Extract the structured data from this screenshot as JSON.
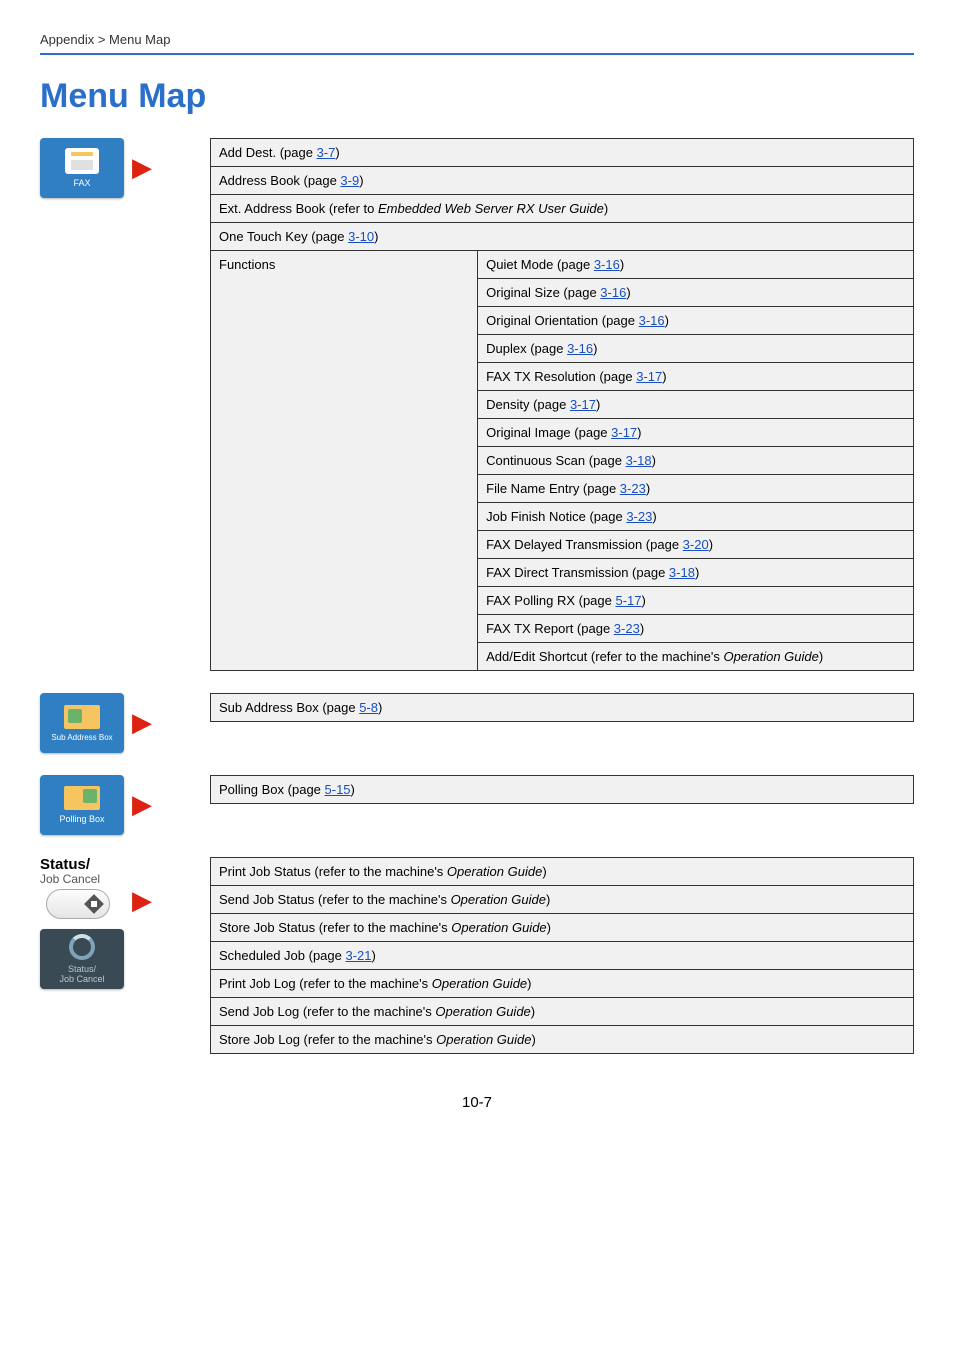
{
  "breadcrumb": "Appendix > Menu Map",
  "title": "Menu Map",
  "page_number": "10-7",
  "fax_tile_label": "FAX",
  "sub_tile_label": "Sub Address Box",
  "poll_tile_label": "Polling Box",
  "status_label_line1": "Status/",
  "status_label_line2": "Job Cancel",
  "status_screen_line1": "Status/",
  "status_screen_line2": "Job Cancel",
  "fax_table": {
    "rows": [
      {
        "full": [
          {
            "t": "Add Dest. (page "
          },
          {
            "link": "3-7"
          },
          {
            "t": ")"
          }
        ]
      },
      {
        "full": [
          {
            "t": "Address Book (page "
          },
          {
            "link": "3-9"
          },
          {
            "t": ")"
          }
        ]
      },
      {
        "full": [
          {
            "t": "Ext. Address Book (refer to "
          },
          {
            "i": "Embedded Web Server RX User Guide"
          },
          {
            "t": ")"
          }
        ]
      },
      {
        "full": [
          {
            "t": "One Touch Key (page "
          },
          {
            "link": "3-10"
          },
          {
            "t": ")"
          }
        ]
      }
    ],
    "functions_label": "Functions",
    "functions": [
      [
        {
          "t": "Quiet Mode (page "
        },
        {
          "link": "3-16"
        },
        {
          "t": ")"
        }
      ],
      [
        {
          "t": "Original Size (page "
        },
        {
          "link": "3-16"
        },
        {
          "t": ")"
        }
      ],
      [
        {
          "t": "Original Orientation (page "
        },
        {
          "link": "3-16"
        },
        {
          "t": ")"
        }
      ],
      [
        {
          "t": "Duplex (page "
        },
        {
          "link": "3-16"
        },
        {
          "t": ")"
        }
      ],
      [
        {
          "t": "FAX TX Resolution (page "
        },
        {
          "link": "3-17"
        },
        {
          "t": ")"
        }
      ],
      [
        {
          "t": "Density (page "
        },
        {
          "link": "3-17"
        },
        {
          "t": ")"
        }
      ],
      [
        {
          "t": "Original Image (page "
        },
        {
          "link": "3-17"
        },
        {
          "t": ")"
        }
      ],
      [
        {
          "t": "Continuous Scan (page "
        },
        {
          "link": "3-18"
        },
        {
          "t": ")"
        }
      ],
      [
        {
          "t": "File Name Entry (page "
        },
        {
          "link": "3-23"
        },
        {
          "t": ")"
        }
      ],
      [
        {
          "t": "Job Finish Notice (page "
        },
        {
          "link": "3-23"
        },
        {
          "t": ")"
        }
      ],
      [
        {
          "t": "FAX Delayed Transmission (page "
        },
        {
          "link": "3-20"
        },
        {
          "t": ")"
        }
      ],
      [
        {
          "t": "FAX Direct Transmission (page "
        },
        {
          "link": "3-18"
        },
        {
          "t": ")"
        }
      ],
      [
        {
          "t": "FAX Polling RX (page "
        },
        {
          "link": "5-17"
        },
        {
          "t": ")"
        }
      ],
      [
        {
          "t": "FAX TX Report (page "
        },
        {
          "link": "3-23"
        },
        {
          "t": ")"
        }
      ],
      [
        {
          "t": "Add/Edit Shortcut (refer to the machine's "
        },
        {
          "i": "Operation Guide"
        },
        {
          "t": ")"
        }
      ]
    ]
  },
  "sub_row": [
    {
      "t": "Sub Address Box (page "
    },
    {
      "link": "5-8"
    },
    {
      "t": ")"
    }
  ],
  "poll_row": [
    {
      "t": "Polling Box (page "
    },
    {
      "link": "5-15"
    },
    {
      "t": ")"
    }
  ],
  "status_rows": [
    [
      {
        "t": "Print Job Status (refer to the machine's "
      },
      {
        "i": "Operation Guide"
      },
      {
        "t": ")"
      }
    ],
    [
      {
        "t": "Send Job Status (refer to the machine's "
      },
      {
        "i": "Operation Guide"
      },
      {
        "t": ")"
      }
    ],
    [
      {
        "t": "Store Job Status (refer to the machine's "
      },
      {
        "i": "Operation Guide"
      },
      {
        "t": ")"
      }
    ],
    [
      {
        "t": "Scheduled Job (page "
      },
      {
        "link": "3-21"
      },
      {
        "t": ")"
      }
    ],
    [
      {
        "t": "Print Job Log (refer to the machine's "
      },
      {
        "i": "Operation Guide"
      },
      {
        "t": ")"
      }
    ],
    [
      {
        "t": "Send Job Log (refer to the machine's "
      },
      {
        "i": "Operation Guide"
      },
      {
        "t": ")"
      }
    ],
    [
      {
        "t": "Store Job Log (refer to the machine's "
      },
      {
        "i": "Operation Guide"
      },
      {
        "t": ")"
      }
    ]
  ]
}
